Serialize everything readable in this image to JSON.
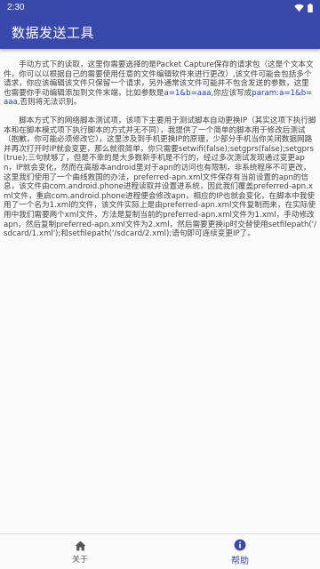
{
  "status_bar": {
    "time": "2:30",
    "icons": [
      "wifi-icon",
      "battery-icon"
    ]
  },
  "app_bar": {
    "title": "数据发送工具"
  },
  "content": {
    "paragraph1": {
      "text_before": "手动方式下的读取，这里你需要选择的是Packet Capture保存的请求包（这是个文本文件，你可以以根据自己的需要使用任意的文件编辑软件来进行更改）,该文件可能会包括多个请求，你应该编辑该文件只保留一个请求，另外通常该文件可能并不包含发送的参数，这里也需要你手动编辑添加到文件末端，比如参数是",
      "param_example_1": "a=1&b=aaa",
      "text_middle": ",你应该写成",
      "param_example_2": "param:a=1&b=aaa",
      "text_after": ",否则将无法识别。"
    },
    "paragraph2": {
      "text": "脚本方式下的网络脚本测试项，该项下主要用于测试脚本自动更换IP（其实这项下执行脚本和在脚本模式项下执行脚本的方式并无不同），我提供了一个简单的脚本用于修改后测试（抱歉，你可能必须修改它），这里涉及到手机更换IP的原理，少部分手机当你关闭数据网路并再次打开时IP就会变更，那么就很简单，你只需要setwifi(false);setgprs(false);setgprs(true);三句就够了，但是不幸的是大多数新手机是不行的，经过多次测试发现通过变更apn，IP就会变化，然而在高版本android里对于apn的访问也有限制，非系统程序不可更改，这里我们使用了一个曲线救国的办法，preferred-apn.xml文件保存有当前设置的apn的信息，该文件由com.android.phone进程读取并设置进系统，因此我们覆盖preferred-apn.xml文件，重启com.android.phone进程便会修改apn，相应的IP也就会变化，在脚本中我使用了一个名为1.xml的文件，该文件实际上是由preferred-apn.xml文件复制而来，在实际使用中我们需要两个xml文件，方法是复制当前的preferred-apn.xml文件为1.xml，手动修改apn，然后复制preferred-apn.xml文件为2.xml，然后需要更换ip时交替使用setfilepath('/sdcard/1.xml');和setfilepath('/sdcard/2.xml);语句即可连续变更IP了。"
    }
  },
  "bottom_nav": {
    "items": [
      {
        "label": "关于",
        "icon": "home-icon",
        "active": false
      },
      {
        "label": "帮助",
        "icon": "info-icon",
        "active": true
      }
    ]
  },
  "colors": {
    "primary": "#3949ab",
    "link_text": "#1e3fbf",
    "body_text": "#444444",
    "background": "#fafafa"
  }
}
